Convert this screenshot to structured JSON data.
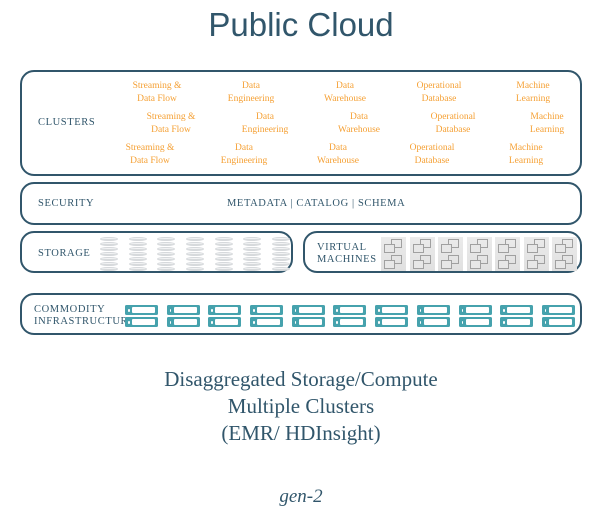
{
  "title": "Public Cloud",
  "clusters": {
    "label": "CLUSTERS",
    "rows": [
      [
        "Streaming &\nData Flow",
        "Data\nEngineering",
        "Data\nWarehouse",
        "Operational\nDatabase",
        "Machine\nLearning"
      ],
      [
        "Streaming &\nData Flow",
        "Data\nEngineering",
        "Data\nWarehouse",
        "Operational\nDatabase",
        "Machine\nLearning"
      ],
      [
        "Streaming &\nData Flow",
        "Data\nEngineering",
        "Data\nWarehouse",
        "Operational\nDatabase",
        "Machine\nLearning"
      ]
    ]
  },
  "security": {
    "label": "SECURITY",
    "items": "METADATA   |   CATALOG   |   SCHEMA"
  },
  "storage": {
    "label": "STORAGE",
    "icon_count": 7,
    "disks_per_stack": 7,
    "icon_name": "disk-stack-icon"
  },
  "virtual_machines": {
    "label": "VIRTUAL\nMACHINES",
    "label_line1": "VIRTUAL",
    "label_line2": "MACHINES",
    "icon_count": 7,
    "icon_name": "virtual-machine-icon"
  },
  "commodity": {
    "label_line1": "COMMODITY",
    "label_line2": "INFRASTRUCTURE",
    "icon_count": 11,
    "icon_name": "server-rack-icon"
  },
  "caption": {
    "line1": "Disaggregated Storage/Compute",
    "line2": "Multiple Clusters",
    "line3": "(EMR/ HDInsight)"
  },
  "gen_label": "gen-2",
  "colors": {
    "accent_blue": "#31566b",
    "cluster_orange": "#f5a034",
    "server_teal": "#46a2ad",
    "disk_gray": "#d6d9dc",
    "vm_gray": "#a0a0a0",
    "background": "#ffffff"
  }
}
